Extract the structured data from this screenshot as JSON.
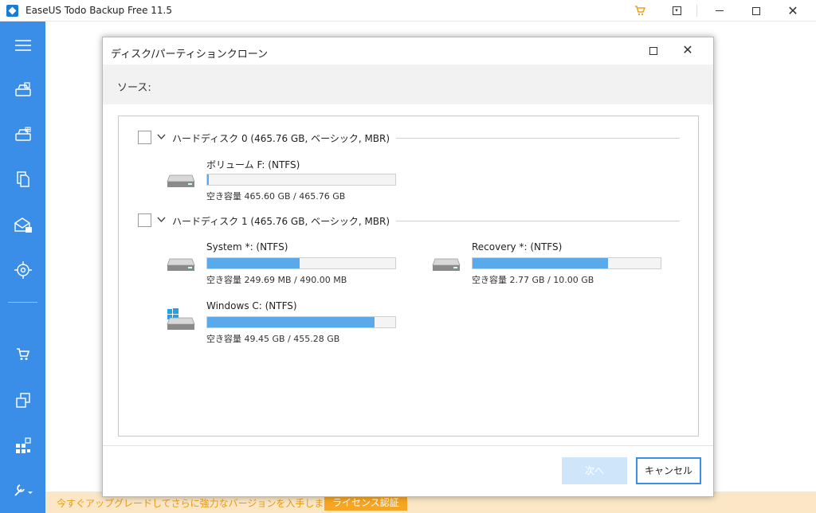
{
  "app": {
    "title": "EaseUS Todo Backup Free 11.5"
  },
  "titlebar": {
    "cart_icon": "cart-icon",
    "menu_icon": "dropdown-menu-icon",
    "minimize_icon": "minimize-icon",
    "maximize_icon": "maximize-icon",
    "close_glyph": "✕"
  },
  "sidebar": {
    "color": "#3a8ee8",
    "items": [
      {
        "icon": "hamburger-menu-icon"
      },
      {
        "icon": "disk-backup-icon"
      },
      {
        "icon": "system-backup-icon"
      },
      {
        "icon": "file-backup-icon"
      },
      {
        "icon": "mail-backup-icon"
      },
      {
        "icon": "smart-backup-icon"
      },
      {
        "icon": "cart-icon"
      },
      {
        "icon": "clone-icon"
      },
      {
        "icon": "apps-icon"
      },
      {
        "icon": "tools-icon"
      }
    ]
  },
  "banner": {
    "text": "今すぐアップグレードしてさらに強力なバージョンを入手しましょう。",
    "button": "ライセンス認証"
  },
  "dialog": {
    "title": "ディスク/パーティションクローン",
    "source_label": "ソース:",
    "close_glyph": "✕",
    "disks": [
      {
        "title": "ハードディスク 0 (465.76 GB, ベーシック, MBR)",
        "partitions": [
          {
            "name": "ボリューム F: (NTFS)",
            "free": "空き容量 465.60 GB / 465.76 GB",
            "used_fraction": 0.0003,
            "icon": "drive-icon"
          }
        ]
      },
      {
        "title": "ハードディスク 1 (465.76 GB, ベーシック, MBR)",
        "partitions": [
          {
            "name": "System *: (NTFS)",
            "free": "空き容量 249.69 MB / 490.00 MB",
            "used_fraction": 0.49,
            "icon": "drive-icon"
          },
          {
            "name": "Recovery *: (NTFS)",
            "free": "空き容量 2.77 GB / 10.00 GB",
            "used_fraction": 0.72,
            "icon": "drive-icon"
          },
          {
            "name": "Windows C: (NTFS)",
            "free": "空き容量 49.45 GB / 455.28 GB",
            "used_fraction": 0.89,
            "icon": "windows-drive-icon"
          }
        ]
      }
    ],
    "buttons": {
      "next": "次へ",
      "cancel": "キャンセル"
    }
  }
}
